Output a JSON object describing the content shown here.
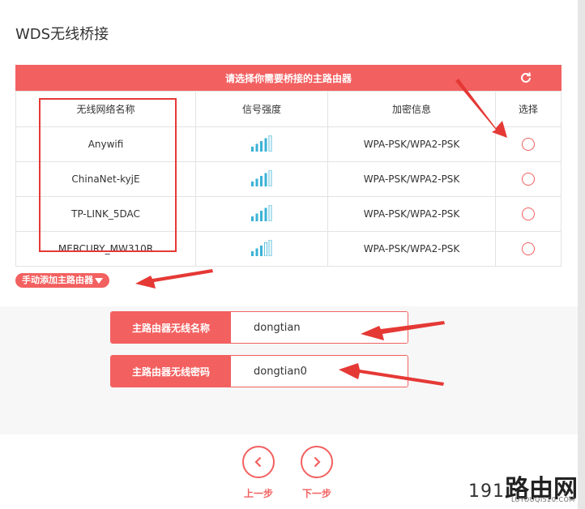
{
  "page": {
    "title": "WDS无线桥接"
  },
  "table": {
    "heading": "请选择你需要桥接的主路由器",
    "columns": [
      "无线网络名称",
      "信号强度",
      "加密信息",
      "选择"
    ],
    "rows": [
      {
        "ssid": "Anywifi",
        "signal": 4,
        "security": "WPA-PSK/WPA2-PSK"
      },
      {
        "ssid": "ChinaNet-kyjE",
        "signal": 4,
        "security": "WPA-PSK/WPA2-PSK"
      },
      {
        "ssid": "TP-LINK_5DAC",
        "signal": 4,
        "security": "WPA-PSK/WPA2-PSK"
      },
      {
        "ssid": "MERCURY_MW310R",
        "signal": 3,
        "security": "WPA-PSK/WPA2-PSK"
      }
    ]
  },
  "manual": {
    "label": "手动添加主路由器"
  },
  "form": {
    "ssid_label": "主路由器无线名称",
    "ssid_value": "dongtian",
    "password_label": "主路由器无线密码",
    "password_value": "dongtian0"
  },
  "nav": {
    "prev_label": "上一步",
    "next_label": "下一步"
  },
  "watermark": {
    "num": "191",
    "cn": "路由网",
    "url": "LUYOUQI520.COM"
  },
  "colors": {
    "accent": "#f36060",
    "signal": "#3bb2d6",
    "annotation": "#e53935"
  }
}
